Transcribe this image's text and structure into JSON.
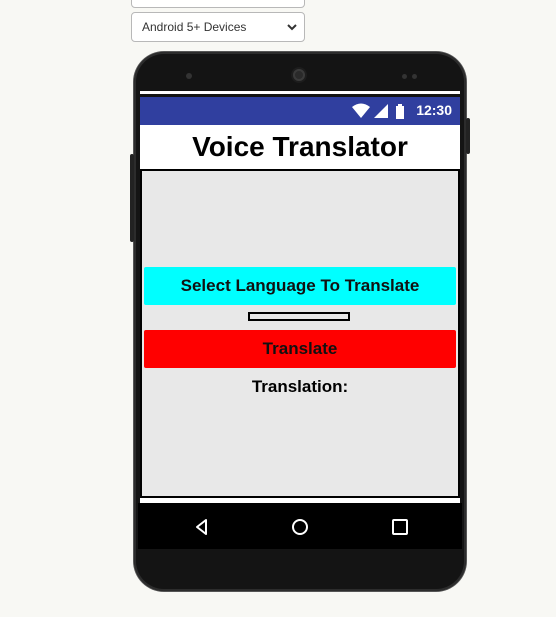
{
  "device_select": {
    "selected": "Android 5+ Devices"
  },
  "status_bar": {
    "time": "12:30",
    "icons": [
      "wifi-icon",
      "signal-icon",
      "battery-icon"
    ]
  },
  "app": {
    "title": "Voice Translator",
    "select_language_label": "Select Language To Translate",
    "translate_label": "Translate",
    "translation_label": "Translation:",
    "textbox_value": ""
  },
  "nav_bar": {
    "icons": [
      "back-icon",
      "home-icon",
      "recents-icon"
    ]
  },
  "colors": {
    "status_bar": "#303f9f",
    "select_button": "#00ffff",
    "translate_button": "#ff0000",
    "content_bg": "#e8e8e8"
  }
}
